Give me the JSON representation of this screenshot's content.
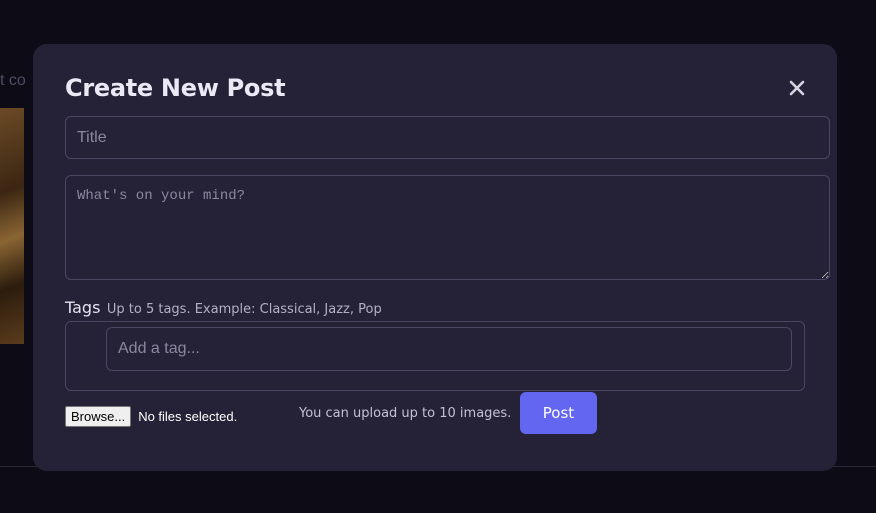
{
  "background": {
    "text_fragment": "t co"
  },
  "modal": {
    "title": "Create New Post",
    "close_icon": "close-icon",
    "title_input": {
      "placeholder": "Title",
      "value": ""
    },
    "body_textarea": {
      "placeholder": "What's on your mind?",
      "value": ""
    },
    "tags": {
      "label": "Tags",
      "hint": "Up to 5 tags. Example: Classical, Jazz, Pop",
      "input_placeholder": "Add a tag..."
    },
    "file_upload": {
      "browse_label": "Browse...",
      "status": "No files selected.",
      "hint": "You can upload up to 10 images."
    },
    "post_button_label": "Post"
  },
  "colors": {
    "page_background": "#0d0c16",
    "modal_background": "#252238",
    "border": "#4a4762",
    "accent": "#6366f1",
    "title_text": "#ebe9f5"
  }
}
